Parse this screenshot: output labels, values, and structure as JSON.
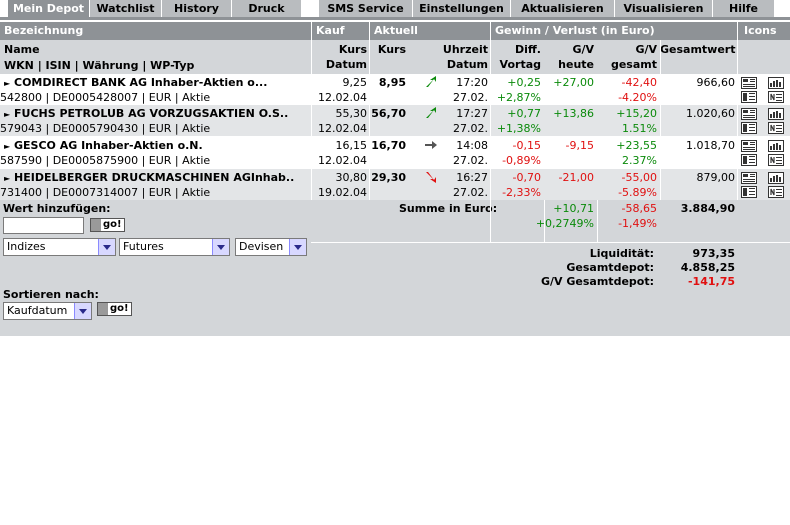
{
  "tabs": [
    {
      "label": "Mein Depot"
    },
    {
      "label": "Watchlist"
    },
    {
      "label": "History"
    },
    {
      "label": "Druck"
    },
    {
      "label": "SMS Service"
    },
    {
      "label": "Einstellungen"
    },
    {
      "label": "Aktualisieren"
    },
    {
      "label": "Visualisieren"
    },
    {
      "label": "Hilfe"
    }
  ],
  "section_headers": {
    "bezeichnung": "Bezeichnung",
    "kauf": "Kauf",
    "aktuell": "Aktuell",
    "gewinn": "Gewinn / Verlust  (in Euro)",
    "icons": "Icons"
  },
  "columns": {
    "name": "Name",
    "wkn": "WKN | ISIN | Währung | WP-Typ",
    "kurs_kauf_1": "Kurs",
    "kurs_kauf_2": "Datum",
    "kurs_akt": "Kurs",
    "uhrzeit_1": "Uhrzeit",
    "uhrzeit_2": "Datum",
    "diff_1": "Diff.",
    "diff_2": "Vortag",
    "gv_heute_1": "G/V",
    "gv_heute_2": "heute",
    "gv_gesamt_1": "G/V",
    "gv_gesamt_2": "gesamt",
    "gesamtwert": "Gesamtwert"
  },
  "rows": [
    {
      "name": "COMDIRECT BANK AG Inhaber-Aktien o...",
      "info": "542800 | DE0005428007 | EUR | Aktie",
      "kauf_kurs": "9,25",
      "kauf_datum": "12.02.04",
      "akt_kurs": "8,95",
      "trend": "up",
      "uhrzeit": "17:20",
      "datum": "27.02.",
      "diff_abs": "+0,25",
      "diff_pct": "+2,87%",
      "gv_heute": "+27,00",
      "gv_gesamt": "-42,40",
      "gv_gesamt_pct": "-4.20%",
      "gesamtwert": "966,60"
    },
    {
      "name": "FUCHS PETROLUB AG VORZUGSAKTIEN O.S..",
      "info": "579043 | DE0005790430 | EUR | Aktie",
      "kauf_kurs": "55,30",
      "kauf_datum": "12.02.04",
      "akt_kurs": "56,70",
      "trend": "up",
      "uhrzeit": "17:27",
      "datum": "27.02.",
      "diff_abs": "+0,77",
      "diff_pct": "+1,38%",
      "gv_heute": "+13,86",
      "gv_gesamt": "+15,20",
      "gv_gesamt_pct": "1.51%",
      "gesamtwert": "1.020,60"
    },
    {
      "name": "GESCO AG Inhaber-Aktien o.N.",
      "info": "587590 | DE0005875900 | EUR | Aktie",
      "kauf_kurs": "16,15",
      "kauf_datum": "12.02.04",
      "akt_kurs": "16,70",
      "trend": "flat",
      "uhrzeit": "14:08",
      "datum": "27.02.",
      "diff_abs": "-0,15",
      "diff_pct": "-0,89%",
      "gv_heute": "-9,15",
      "gv_gesamt": "+23,55",
      "gv_gesamt_pct": "2.37%",
      "gesamtwert": "1.018,70"
    },
    {
      "name": "HEIDELBERGER DRUCKMASCHINEN AGInhab..",
      "info": "731400 | DE0007314007 | EUR | Aktie",
      "kauf_kurs": "30,80",
      "kauf_datum": "19.02.04",
      "akt_kurs": "29,30",
      "trend": "down",
      "uhrzeit": "16:27",
      "datum": "27.02.",
      "diff_abs": "-0,70",
      "diff_pct": "-2,33%",
      "gv_heute": "-21,00",
      "gv_gesamt": "-55,00",
      "gv_gesamt_pct": "-5.89%",
      "gesamtwert": "879,00"
    }
  ],
  "add": {
    "label": "Wert hinzufügen:",
    "go": "go!",
    "input_value": "",
    "select1": "Indizes",
    "select2": "Futures",
    "select3": "Devisen"
  },
  "sort": {
    "label": "Sortieren nach:",
    "value": "Kaufdatum",
    "go": "go!"
  },
  "summary": {
    "label": "Summe in Euro:",
    "gv_heute_abs": "+10,71",
    "gv_heute_pct": "+0,2749%",
    "gv_gesamt_abs": "-58,65",
    "gv_gesamt_pct": "-1,49%",
    "gesamtwert": "3.884,90"
  },
  "totals": {
    "liquiditaet_label": "Liquidität:",
    "liquiditaet": "973,35",
    "gesamtdepot_label": "Gesamtdepot:",
    "gesamtdepot": "4.858,25",
    "gv_depot_label": "G/V Gesamtdepot:",
    "gv_depot": "-141,75"
  },
  "colors": {
    "header": "#8e9296",
    "panel": "#d3d6d9",
    "positive": "#0a8a0a",
    "negative": "#e01010"
  }
}
